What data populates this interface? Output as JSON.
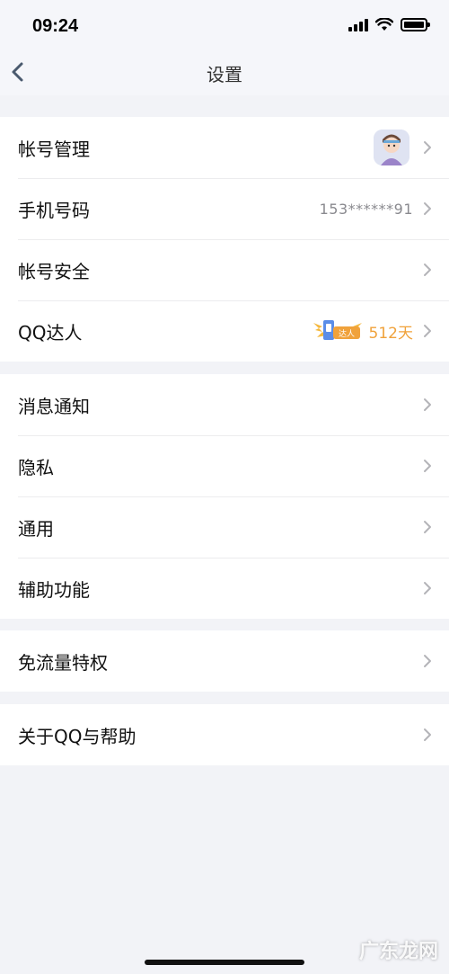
{
  "status": {
    "time": "09:24"
  },
  "nav": {
    "title": "设置",
    "back_icon": "chevron-left-icon"
  },
  "groups": [
    {
      "rows": [
        {
          "label": "帐号管理",
          "value": "",
          "right": "avatar"
        },
        {
          "label": "手机号码",
          "value": "153******91"
        },
        {
          "label": "帐号安全",
          "value": ""
        },
        {
          "label": "QQ达人",
          "badge_text": "达人",
          "days": "512天"
        }
      ]
    },
    {
      "rows": [
        {
          "label": "消息通知"
        },
        {
          "label": "隐私"
        },
        {
          "label": "通用"
        },
        {
          "label": "辅助功能"
        }
      ]
    },
    {
      "rows": [
        {
          "label": "免流量特权"
        }
      ]
    },
    {
      "rows": [
        {
          "label": "关于QQ与帮助"
        }
      ]
    }
  ],
  "watermark": "广东龙网",
  "colors": {
    "accent_days": "#f0a23b",
    "background": "#f2f3f7"
  }
}
